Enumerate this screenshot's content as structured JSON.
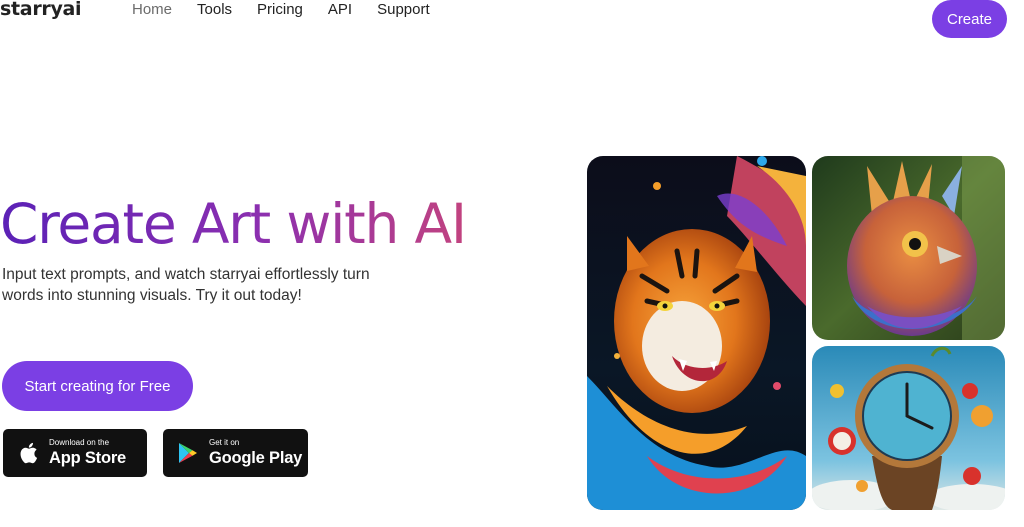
{
  "brand": {
    "logo": "starryai"
  },
  "nav": {
    "items": [
      {
        "label": "Home",
        "muted": true
      },
      {
        "label": "Tools"
      },
      {
        "label": "Pricing"
      },
      {
        "label": "API"
      },
      {
        "label": "Support"
      }
    ],
    "create_label": "Create"
  },
  "hero": {
    "title": "Create Art with AI",
    "subtitle": "Input text prompts, and watch starryai effortlessly turn words into stunning visuals. Try it out today!",
    "cta_label": "Start creating for Free"
  },
  "stores": {
    "apple": {
      "small": "Download on the",
      "big": "App Store",
      "icon": "apple-icon"
    },
    "google": {
      "small": "Get it on",
      "big": "Google Play",
      "icon": "google-play-icon"
    }
  },
  "colors": {
    "accent": "#7b3fe4",
    "gradient_start": "#5b21b6",
    "gradient_end": "#c2437f"
  },
  "gallery": [
    "tiger-painting",
    "bird-painting",
    "clock-painting"
  ]
}
